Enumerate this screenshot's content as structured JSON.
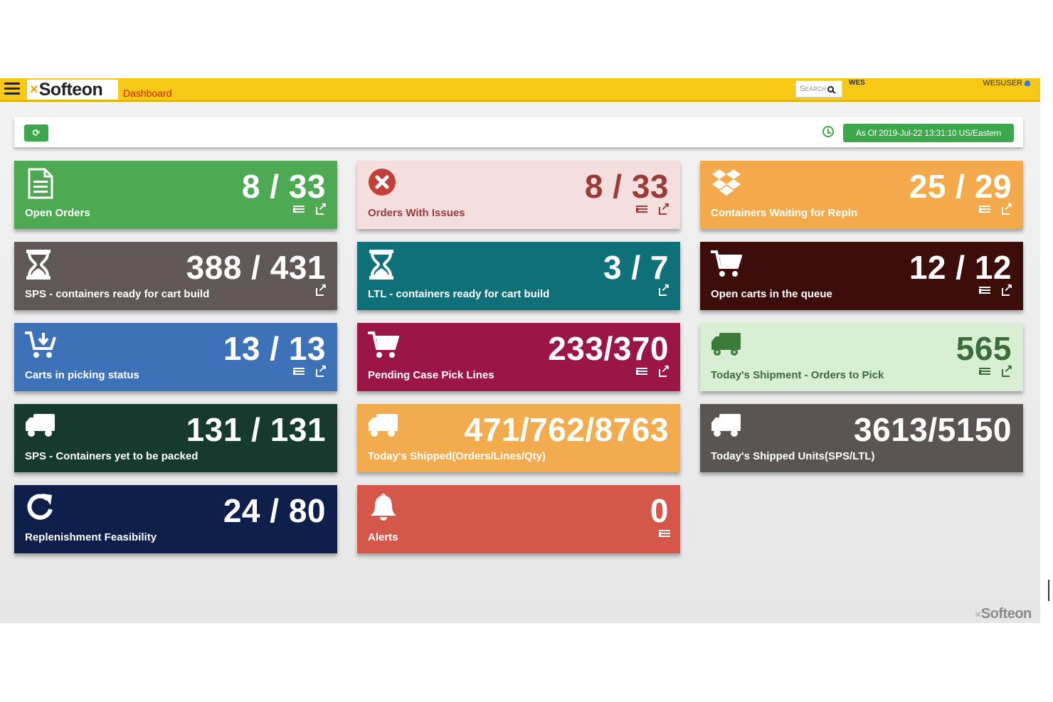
{
  "header": {
    "logo_x": "×",
    "logo_text": "Softeon",
    "breadcrumb": "Dashboard",
    "search_placeholder": "Search",
    "environment": "WES",
    "user": "WESUSER"
  },
  "toolbar": {
    "refresh_icon": "⟳",
    "as_of": "As Of 2019-Jul-22 13:31:10 US/Eastern"
  },
  "tiles": [
    {
      "label": "Open Orders",
      "value": "8 / 33",
      "icon": "document-icon",
      "bg": "#4eaa52",
      "fg": "#ffffff"
    },
    {
      "label": "Orders With Issues",
      "value": "8 / 33",
      "icon": "error-circle-icon",
      "bg": "#f4dede",
      "fg": "#9a3b35"
    },
    {
      "label": "Containers Waiting for Repln",
      "value": "25 / 29",
      "icon": "dropbox-icon",
      "bg": "#f4a94b",
      "fg": "#ffffff"
    },
    {
      "label": "SPS - containers ready for cart build",
      "value": "388 / 431",
      "icon": "hourglass-icon",
      "bg": "#5f5857",
      "fg": "#ffffff"
    },
    {
      "label": "LTL - containers ready for cart build",
      "value": "3 / 7",
      "icon": "hourglass-icon",
      "bg": "#0e717a",
      "fg": "#ffffff"
    },
    {
      "label": "Open carts in the queue",
      "value": "12 / 12",
      "icon": "cart-icon",
      "bg": "#3d0d09",
      "fg": "#ffffff"
    },
    {
      "label": "Carts in picking status",
      "value": "13 / 13",
      "icon": "cart-download-icon",
      "bg": "#3e72b8",
      "fg": "#ffffff"
    },
    {
      "label": "Pending Case Pick Lines",
      "value": "233/370",
      "icon": "cart-icon",
      "bg": "#9c1547",
      "fg": "#ffffff"
    },
    {
      "label": "Today's Shipment - Orders to Pick",
      "value": "565",
      "icon": "truck-icon",
      "bg": "#d9efd3",
      "fg": "#3c6b3c"
    },
    {
      "label": "SPS - Containers yet to be packed",
      "value": "131 / 131",
      "icon": "truck-icon",
      "bg": "#163b2e",
      "fg": "#ffffff"
    },
    {
      "label": "Today's Shipped(Orders/Lines/Qty)",
      "value": "471/762/8763",
      "icon": "truck-icon",
      "bg": "#f2ab4d",
      "fg": "#ffffff"
    },
    {
      "label": "Today's Shipped Units(SPS/LTL)",
      "value": "3613/5150",
      "icon": "truck-icon",
      "bg": "#5a5453",
      "fg": "#ffffff"
    },
    {
      "label": "Replenishment Feasibility",
      "value": "24 / 80",
      "icon": "refresh-icon",
      "bg": "#0f1f4c",
      "fg": "#ffffff"
    },
    {
      "label": "Alerts",
      "value": "0",
      "icon": "bell-icon",
      "bg": "#d4574a",
      "fg": "#ffffff"
    }
  ],
  "footer": {
    "logo_x": "×",
    "logo_text": "Softeon"
  }
}
